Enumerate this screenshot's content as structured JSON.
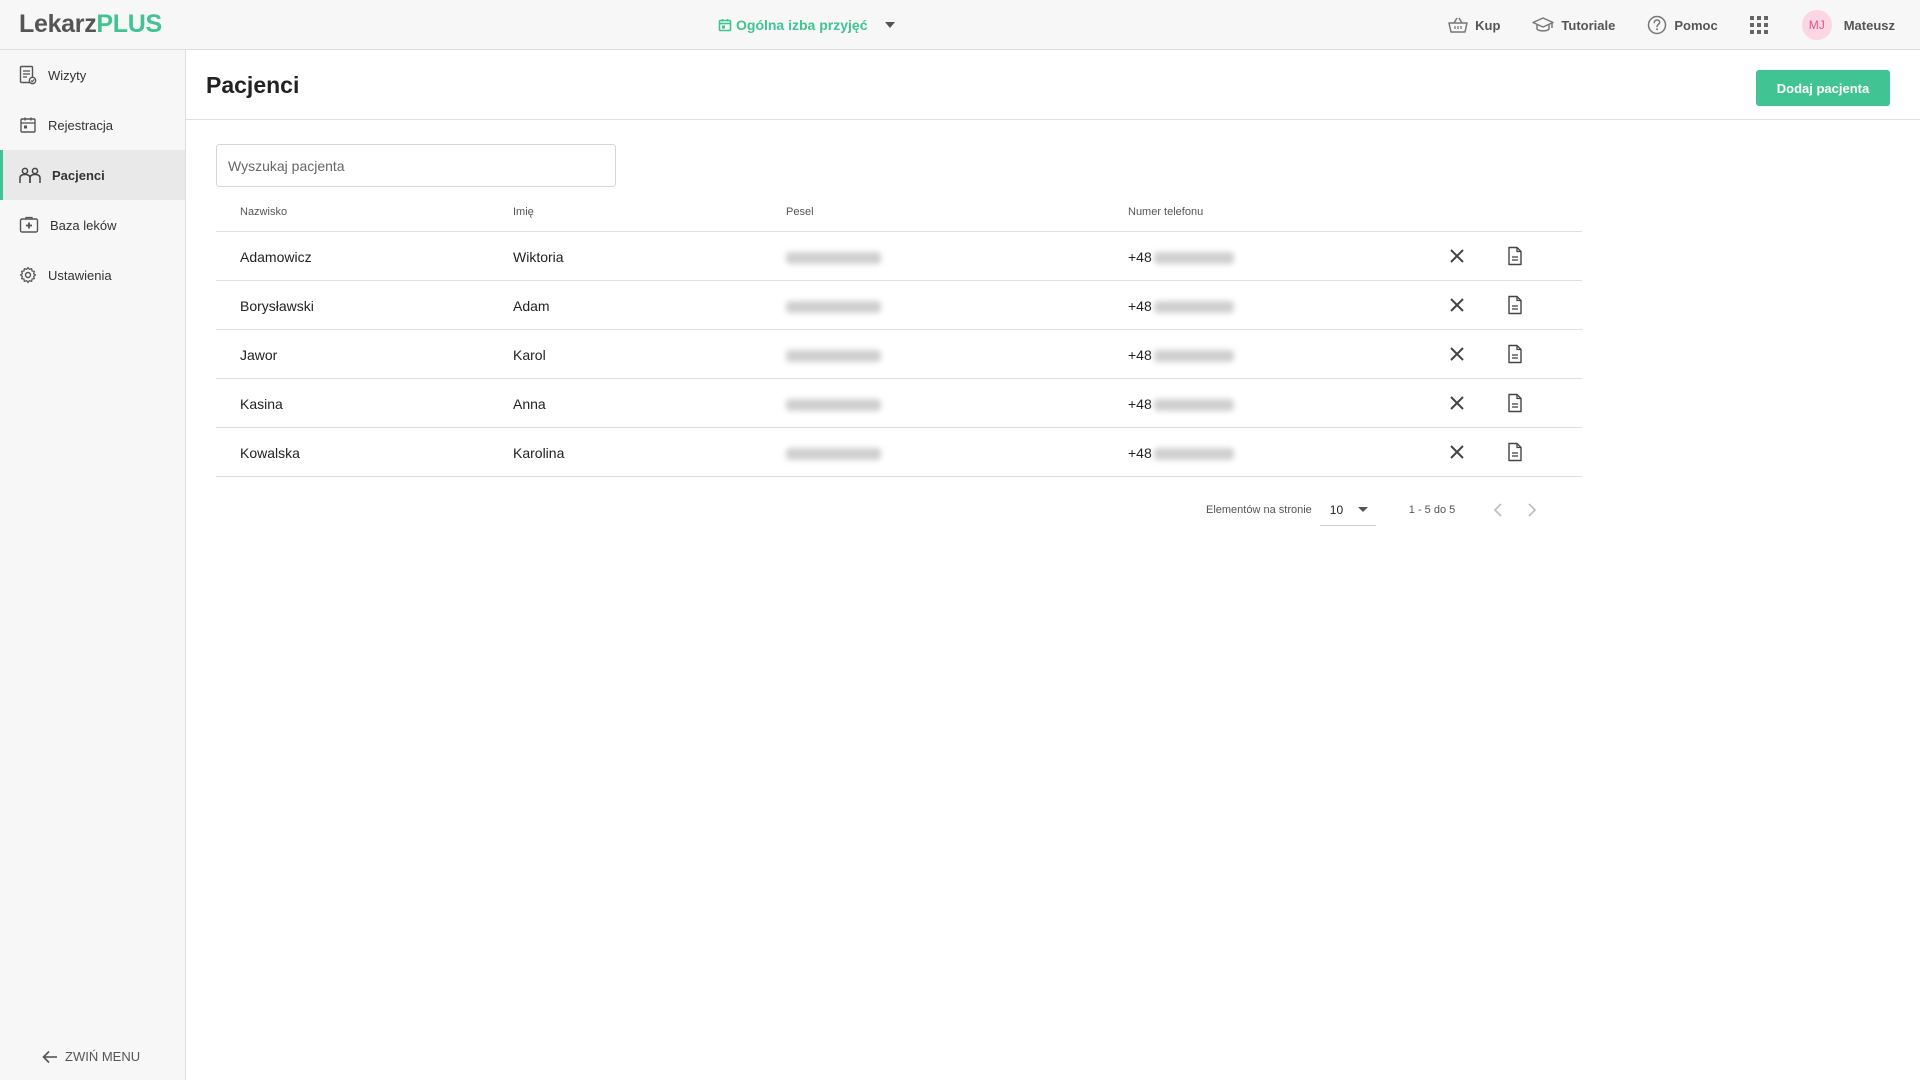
{
  "header": {
    "logo_part1": "Lekarz",
    "logo_part2": "PLUS",
    "location": "Ogólna izba przyjęć",
    "actions": [
      {
        "label": "Kup",
        "icon": "basket-icon"
      },
      {
        "label": "Tutoriale",
        "icon": "graduation-cap-icon"
      },
      {
        "label": "Pomoc",
        "icon": "help-circle-icon"
      }
    ],
    "user_initials": "MJ",
    "user_name": "Mateusz"
  },
  "sidebar": {
    "items": [
      {
        "label": "Wizyty",
        "icon": "visits-icon"
      },
      {
        "label": "Rejestracja",
        "icon": "calendar-icon"
      },
      {
        "label": "Pacjenci",
        "icon": "patients-icon",
        "active": true
      },
      {
        "label": "Baza leków",
        "icon": "medicine-icon"
      },
      {
        "label": "Ustawienia",
        "icon": "settings-icon"
      }
    ],
    "collapse_label": "ZWIŃ MENU"
  },
  "page": {
    "title": "Pacjenci",
    "add_button": "Dodaj pacjenta",
    "search_placeholder": "Wyszukaj pacjenta"
  },
  "table": {
    "columns": [
      "Nazwisko",
      "Imię",
      "Pesel",
      "Numer telefonu"
    ],
    "phone_prefix": "+48",
    "rows": [
      {
        "surname": "Adamowicz",
        "name": "Wiktoria"
      },
      {
        "surname": "Borysławski",
        "name": "Adam"
      },
      {
        "surname": "Jawor",
        "name": "Karol"
      },
      {
        "surname": "Kasina",
        "name": "Anna"
      },
      {
        "surname": "Kowalska",
        "name": "Karolina"
      }
    ]
  },
  "pagination": {
    "per_page_label": "Elementów na stronie",
    "per_page_value": "10",
    "range": "1 - 5 do 5"
  },
  "colors": {
    "accent": "#41c394",
    "avatar_bg": "#fcd6e2",
    "avatar_text": "#e0558a"
  }
}
